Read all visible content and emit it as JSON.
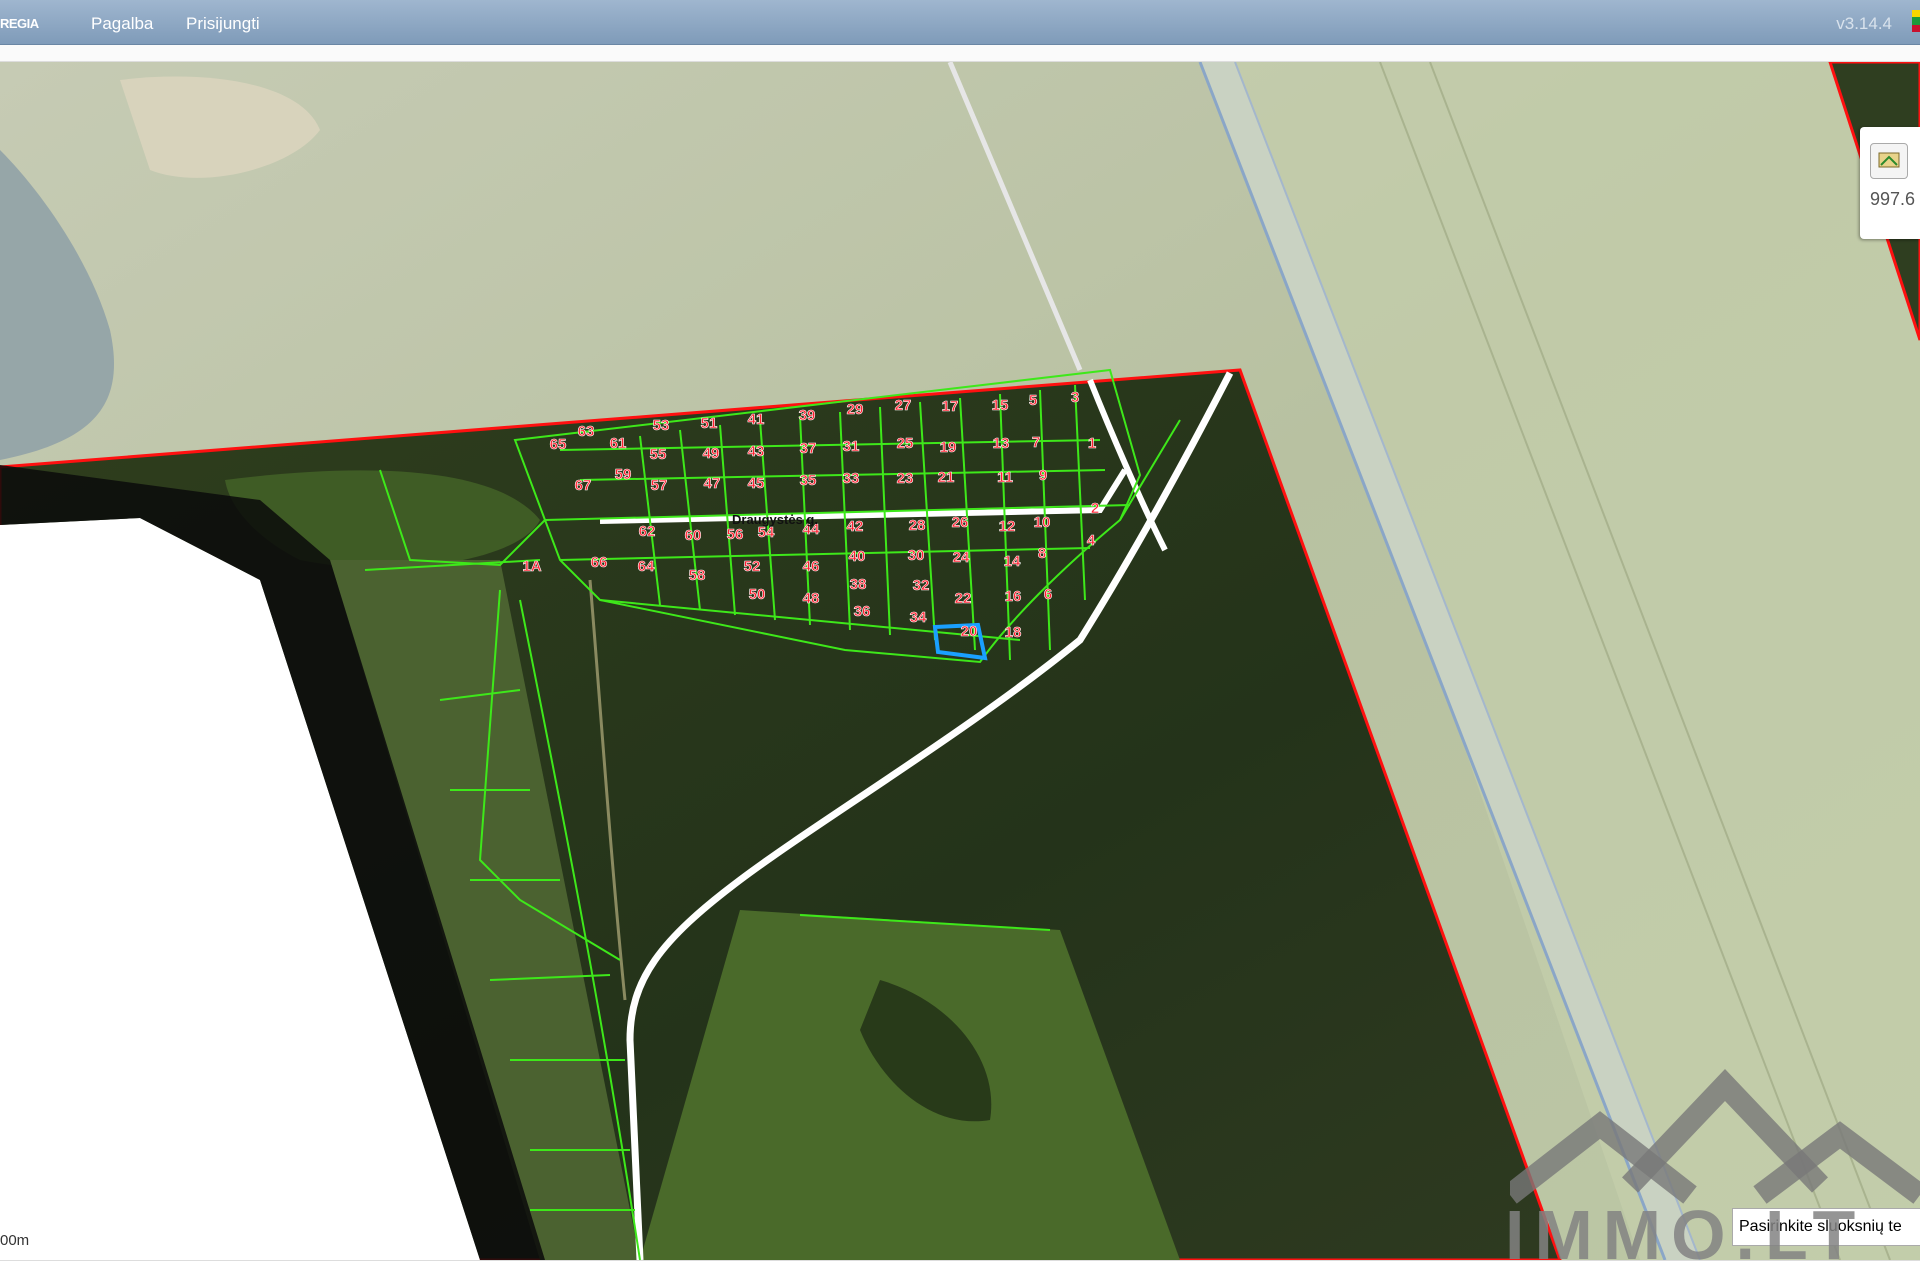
{
  "header": {
    "logo": "REGIA",
    "menu": [
      "Pagalba",
      "Prisijungti"
    ],
    "version": "v3.14.4"
  },
  "map": {
    "street_label": "Draugystės g.",
    "scale_label": "00m",
    "selected_parcel": "20",
    "parcels": [
      "1",
      "2",
      "3",
      "4",
      "5",
      "6",
      "7",
      "8",
      "9",
      "10",
      "11",
      "12",
      "13",
      "14",
      "15",
      "16",
      "17",
      "18",
      "19",
      "20",
      "21",
      "22",
      "23",
      "24",
      "25",
      "26",
      "27",
      "28",
      "29",
      "30",
      "31",
      "32",
      "33",
      "34",
      "35",
      "36",
      "37",
      "38",
      "39",
      "40",
      "41",
      "42",
      "43",
      "44",
      "45",
      "46",
      "47",
      "48",
      "49",
      "50",
      "51",
      "52",
      "53",
      "54",
      "55",
      "56",
      "57",
      "58",
      "59",
      "60",
      "61",
      "62",
      "63",
      "64",
      "65",
      "66",
      "67",
      "1A"
    ],
    "widget_value": "997.6",
    "layer_select_text": "Pasirinkite sluoksnių te",
    "watermark": "IMMO.LT",
    "colors": {
      "parcel_border": "#3ee81a",
      "parcel_label": "#ff2030",
      "zone_border": "#ff1010",
      "selected": "#1aa0ff",
      "road": "#ffffff"
    }
  }
}
